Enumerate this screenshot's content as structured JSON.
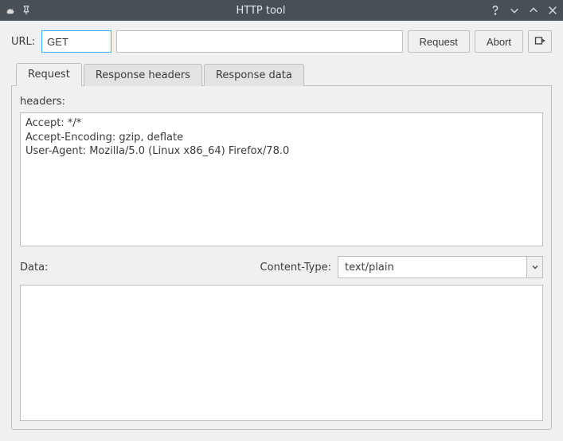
{
  "titlebar": {
    "title": "HTTP tool"
  },
  "url": {
    "label": "URL:",
    "method_value": "GET",
    "address_value": ""
  },
  "buttons": {
    "request": "Request",
    "abort": "Abort"
  },
  "tabs": {
    "request": "Request",
    "response_headers": "Response headers",
    "response_data": "Response data"
  },
  "request_panel": {
    "headers_label": "headers:",
    "headers_value": "Accept: */*\nAccept-Encoding: gzip, deflate\nUser-Agent: Mozilla/5.0 (Linux x86_64) Firefox/78.0",
    "data_label": "Data:",
    "content_type_label": "Content-Type:",
    "content_type_value": "text/plain",
    "data_value": ""
  }
}
